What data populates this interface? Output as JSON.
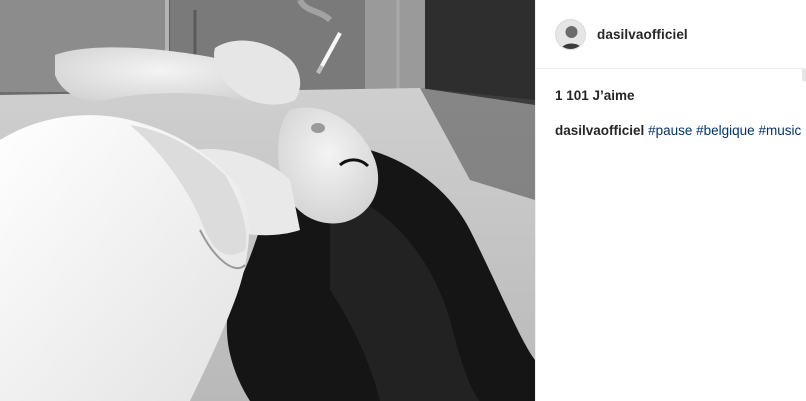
{
  "post": {
    "username": "dasilvaofficiel",
    "likes_text": "1 101 J’aime",
    "caption": {
      "username": "dasilvaofficiel",
      "hashtags": [
        "#pause",
        "#belgique",
        "#music"
      ]
    }
  },
  "icons": {
    "avatar": "profile-avatar"
  },
  "colors": {
    "text": "#262626",
    "hashtag": "#003569",
    "divider": "#efefef"
  }
}
